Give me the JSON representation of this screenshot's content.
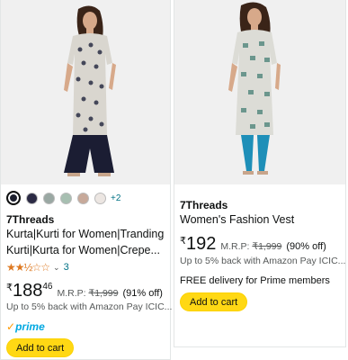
{
  "products": [
    {
      "brand": "7Threads",
      "title_line1": "Kurta|Kurti for Women|Tranding",
      "title_line2": "Kurti|Kurta for Women|Crepe...",
      "stars": "★★½☆☆",
      "rating_value": 2.5,
      "rating_count": "3",
      "currency": "₹",
      "price_whole": "188",
      "price_fraction": "46",
      "mrp_label": "M.R.P:",
      "mrp_value": "₹1,999",
      "discount": "(91% off)",
      "cashback": "Up to 5% back with Amazon Pay ICIC...",
      "prime_label": "prime",
      "add_to_cart": "Add to cart",
      "more_colors": "+2",
      "swatch_colors": [
        "#1c1f2e",
        "#2b2a44",
        "#9aa8a3",
        "#a7bfb1",
        "#c7a99a",
        "#ece6e2"
      ]
    },
    {
      "brand": "7Threads",
      "title": "Women's Fashion Vest",
      "currency": "₹",
      "price_whole": "192",
      "mrp_label": "M.R.P:",
      "mrp_value": "₹1,999",
      "discount": "(90% off)",
      "cashback": "Up to 5% back with Amazon Pay ICIC...",
      "delivery": "FREE delivery for Prime members",
      "add_to_cart": "Add to cart"
    }
  ],
  "colors": {
    "accent_button": "#ffd814",
    "link": "#007185",
    "star": "#de7921",
    "prime": "#00a8e1"
  }
}
